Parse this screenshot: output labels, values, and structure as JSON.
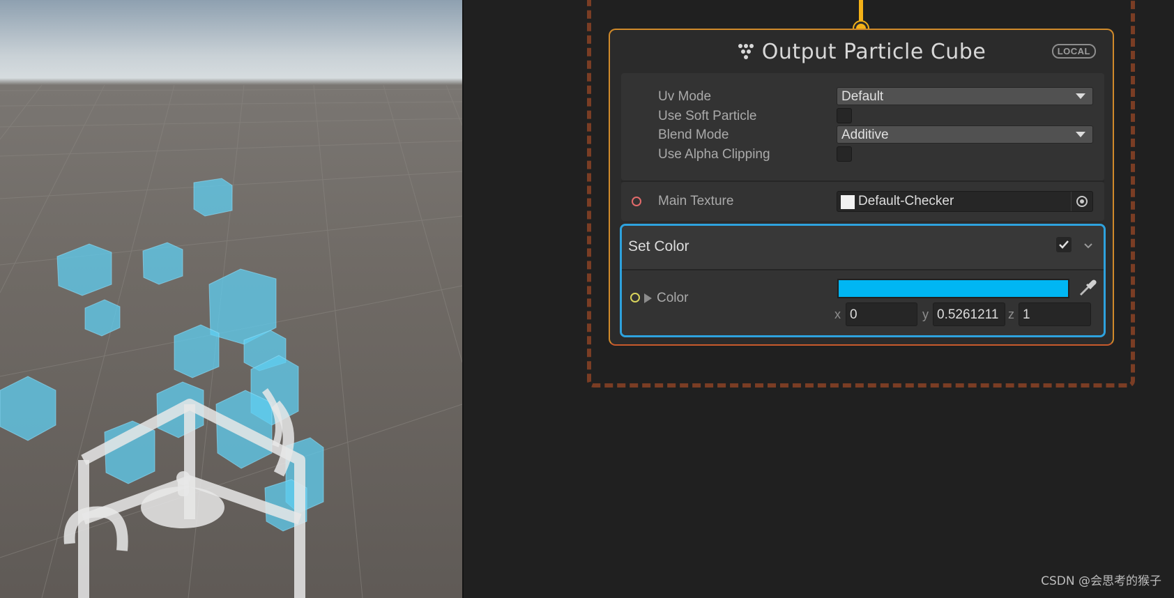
{
  "node": {
    "title": "Output Particle Cube",
    "badge": "LOCAL",
    "settings": [
      {
        "label": "Uv Mode",
        "type": "dropdown",
        "value": "Default"
      },
      {
        "label": "Use Soft Particle",
        "type": "checkbox",
        "checked": false
      },
      {
        "label": "Blend Mode",
        "type": "dropdown",
        "value": "Additive"
      },
      {
        "label": "Use Alpha Clipping",
        "type": "checkbox",
        "checked": false
      }
    ],
    "main_texture": {
      "label": "Main Texture",
      "value": "Default-Checker"
    }
  },
  "block": {
    "title": "Set Color",
    "enabled": true,
    "color": {
      "label": "Color",
      "swatch": "#00b6f3",
      "x_label": "x",
      "x": "0",
      "y_label": "y",
      "y": "0.5261211",
      "z_label": "z",
      "z": "1"
    }
  },
  "colors": {
    "flow": "#f4b117",
    "node_border": "#d18a2a",
    "block_selected": "#2ea2de",
    "group_border": "#7a3d24",
    "particle": "#5fcdf0"
  },
  "watermark": "CSDN @会思考的猴子"
}
